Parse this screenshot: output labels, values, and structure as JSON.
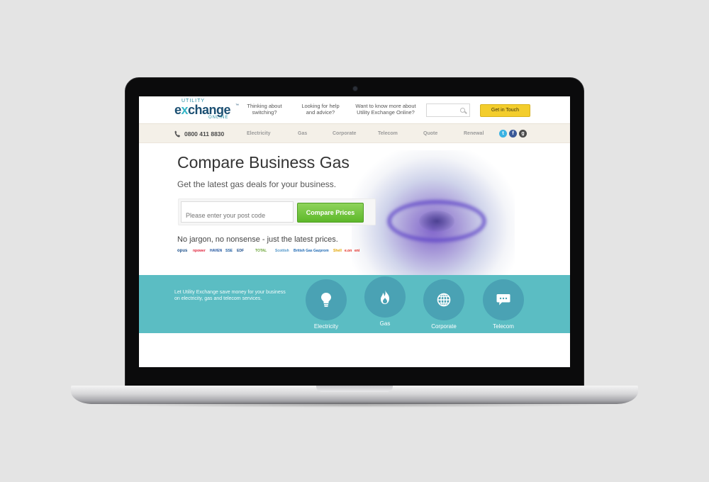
{
  "header": {
    "logo": {
      "top": "UTILITY",
      "main_prefix": "e",
      "main_x": "x",
      "main_suffix": "change",
      "tm": "™",
      "bottom": "ONLINE"
    },
    "links": [
      {
        "line1": "Thinking about",
        "line2": "switching?"
      },
      {
        "line1": "Looking for help",
        "line2": "and advice?"
      },
      {
        "line1": "Want to know more about",
        "line2": "Utility Exchange Online?"
      }
    ],
    "search": {
      "icon": "search-icon"
    },
    "contact_button": "Get in Touch"
  },
  "nav": {
    "phone": "0800 411 8830",
    "items": [
      "Electricity",
      "Gas",
      "Corporate",
      "Telecom",
      "Quote",
      "Renewal"
    ],
    "social": [
      {
        "icon": "twitter-icon",
        "glyph": "t",
        "color": "#3bb3e3"
      },
      {
        "icon": "facebook-icon",
        "glyph": "f",
        "color": "#3b5998"
      },
      {
        "icon": "google-plus-icon",
        "glyph": "g",
        "color": "#4a4a4a"
      }
    ]
  },
  "hero": {
    "title": "Compare Business Gas",
    "subtitle": "Get the latest gas deals for your business.",
    "postcode_placeholder": "Please enter your post code",
    "compare_button": "Compare Prices",
    "tagline": "No jargon, no nonsense - just the latest prices.",
    "suppliers": [
      {
        "name": "opus",
        "color": "#1b4f8a"
      },
      {
        "name": "npower",
        "color": "#e0223b"
      },
      {
        "name": "HAVEN",
        "color": "#1a4f9c"
      },
      {
        "name": "SSE",
        "color": "#1a5aa0"
      },
      {
        "name": "EDF",
        "color": "#1a4d8c"
      },
      {
        "name": "TOTAL",
        "color": "#6aa436"
      },
      {
        "name": "Scottish",
        "color": "#4c93c8"
      },
      {
        "name": "British Gas",
        "color": "#1b67b3"
      },
      {
        "name": "Gazprom",
        "color": "#1b67b3"
      },
      {
        "name": "Shell",
        "color": "#e2a400"
      },
      {
        "name": "e.on",
        "color": "#e2231a"
      },
      {
        "name": "eni",
        "color": "#e2231a"
      }
    ]
  },
  "band": {
    "text": "Let Utility Exchange save money for your business on electricity, gas and telecom services.",
    "services": [
      {
        "label": "Electricity",
        "icon": "lightbulb-icon"
      },
      {
        "label": "Gas",
        "icon": "flame-icon"
      },
      {
        "label": "Corporate",
        "icon": "globe-icon"
      },
      {
        "label": "Telecom",
        "icon": "speech-bubble-icon"
      }
    ]
  }
}
